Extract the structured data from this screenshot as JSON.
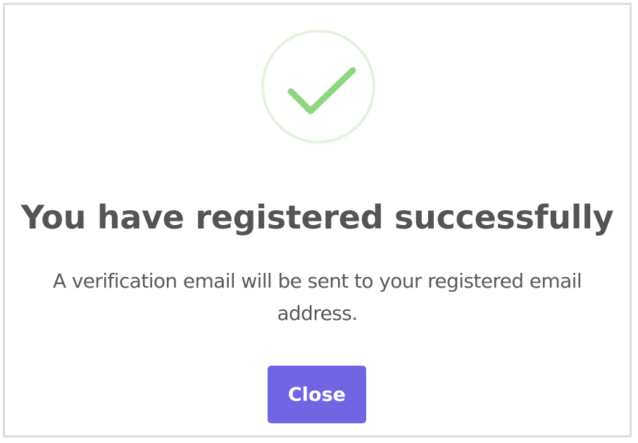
{
  "dialog": {
    "icon": "check-icon",
    "title": "You have registered successfully",
    "message": "A verification email will be sent to your registered email address.",
    "close_label": "Close"
  },
  "colors": {
    "accent": "#7265e3",
    "success": "#8fd681",
    "success_ring": "#e3f3dc",
    "title_text": "#545454",
    "body_text": "#595959",
    "frame_border": "#dcdcdc"
  }
}
